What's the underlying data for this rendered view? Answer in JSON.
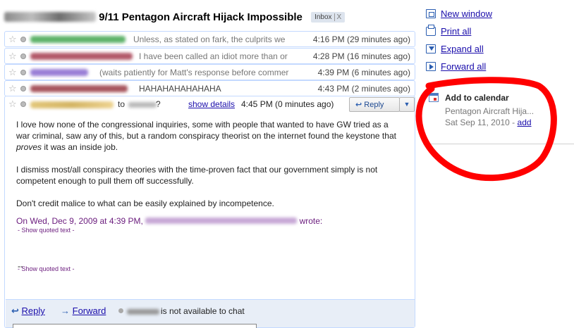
{
  "subject": {
    "title": "9/11 Pentagon Aircraft Hijack Impossible",
    "label": "Inbox",
    "label_close": "X"
  },
  "messages": [
    {
      "snippet": "Unless, as stated on fark, the culprits we",
      "time": "4:16 PM (29 minutes ago)",
      "sender_color": "#5fb36b"
    },
    {
      "snippet": "I have been called an idiot more than or",
      "time": "4:28 PM (16 minutes ago)",
      "sender_color": "#b35a6a"
    },
    {
      "snippet": "(waits patiently for Matt's response before commer",
      "time": "4:39 PM (6 minutes ago)",
      "sender_color": "#9a7fd6"
    },
    {
      "snippet": "HAHAHAHAHAHAHA",
      "time": "4:43 PM (2 minutes ago)",
      "sender_color": "#a8565e"
    }
  ],
  "open_message": {
    "to_label": "to",
    "to_suffix": "?",
    "show_details": "show details",
    "time": "4:45 PM (0 minutes ago)",
    "reply_label": "Reply",
    "dropdown_glyph": "▼",
    "paragraph1_a": "I love how none of the congressional inquiries, some with people that wanted to have GW tried as a war criminal, saw any of this, but a random conspiracy theorist on the internet found the keystone that ",
    "paragraph1_em": "proves",
    "paragraph1_b": " it was an inside job.",
    "paragraph2": "I dismiss most/all conspiracy theories with the time-proven fact that our government simply is not competent enough to pull them off successfully.",
    "paragraph3": "Don't credit malice to what can be easily explained by incompetence.",
    "quote_intro": "On Wed, Dec 9, 2009 at 4:39 PM,",
    "quote_wrote": "wrote:",
    "show_quoted_1": "- Show quoted text -",
    "signature_dashes": "--",
    "show_quoted_2": "- Show quoted text -"
  },
  "footer": {
    "reply": "Reply",
    "forward": "Forward",
    "chat_status": "is not available to chat"
  },
  "side": {
    "links": [
      "New window",
      "Print all",
      "Expand all",
      "Forward all"
    ],
    "calendar": {
      "title": "Add to calendar",
      "event": "Pentagon Aircraft Hija...",
      "date": "Sat Sep 11, 2010 - ",
      "add": "add"
    }
  },
  "colors": {
    "link": "#1a0dab",
    "border": "#c3d9ff",
    "annotation": "#ff0000"
  }
}
